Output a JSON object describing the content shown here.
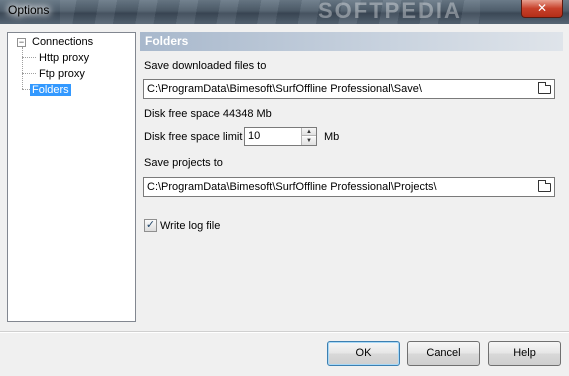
{
  "window": {
    "title": "Options",
    "close_glyph": "✕",
    "watermark": "SOFTPEDIA"
  },
  "tree": {
    "items": [
      {
        "label": "Connections",
        "expanded": true
      },
      {
        "label": "Http proxy"
      },
      {
        "label": "Ftp proxy"
      },
      {
        "label": "Folders",
        "selected": true
      }
    ],
    "toggle_glyph": "−"
  },
  "panel": {
    "header": "Folders",
    "save_downloaded_label": "Save downloaded files to",
    "save_downloaded_path": "C:\\ProgramData\\Bimesoft\\SurfOffline Professional\\Save\\",
    "disk_free_space": "Disk free space 44348 Mb",
    "disk_free_limit_label": "Disk free space limit",
    "disk_free_limit_value": "10",
    "disk_free_limit_unit": "Mb",
    "save_projects_label": "Save projects to",
    "save_projects_path": "C:\\ProgramData\\Bimesoft\\SurfOffline Professional\\Projects\\",
    "write_log_label": "Write log file",
    "write_log_checked": true,
    "check_glyph": "✓",
    "spin_up_glyph": "▲",
    "spin_down_glyph": "▼",
    "browse_icon": "folder-open-icon"
  },
  "buttons": {
    "ok": "OK",
    "cancel": "Cancel",
    "help": "Help"
  },
  "colors": {
    "selection": "#3399ff",
    "header_gradient_start": "#a8b8cc",
    "close_button": "#c7402a"
  }
}
